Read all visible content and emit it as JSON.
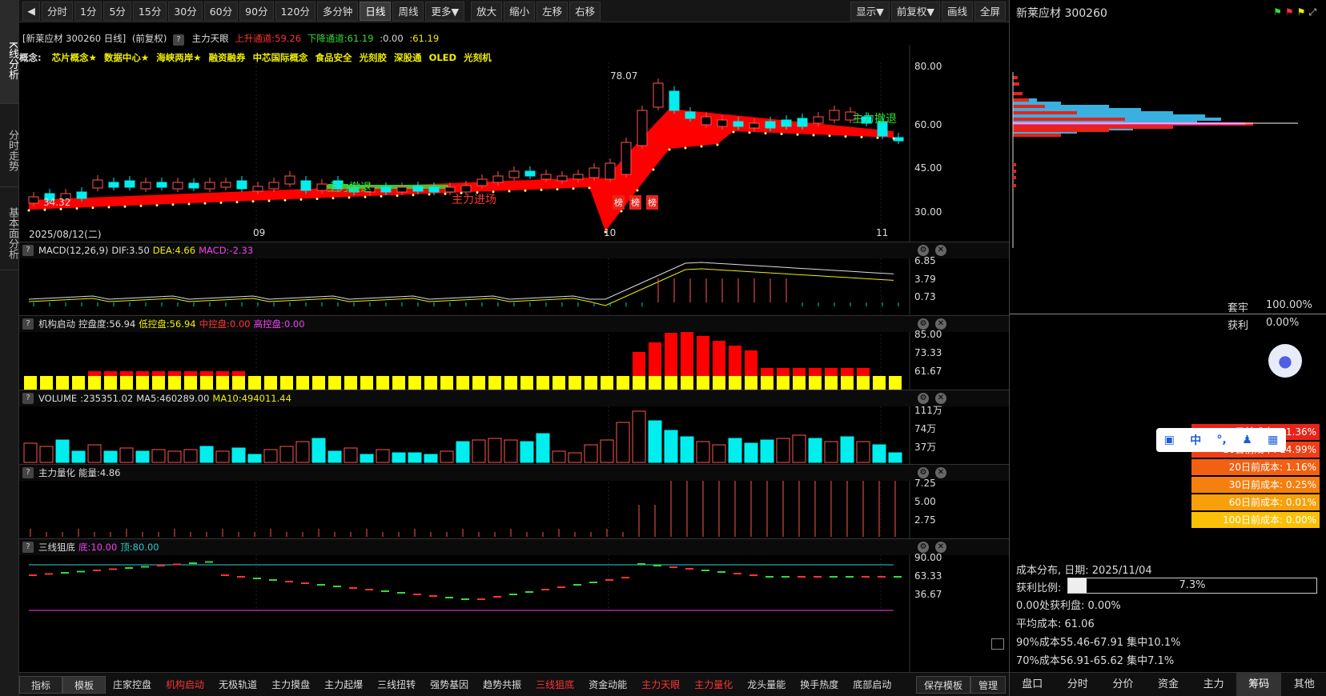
{
  "left_nav": {
    "items": [
      "K线分析",
      "分时走势",
      "基本面分析"
    ]
  },
  "toolbar": {
    "periods": [
      "分时",
      "1分",
      "5分",
      "15分",
      "30分",
      "60分",
      "90分",
      "120分",
      "多分钟",
      "日线",
      "周线",
      "更多▼"
    ],
    "actions": [
      "放大",
      "缩小",
      "左移",
      "右移"
    ],
    "right": [
      "显示▼",
      "前复权▼",
      "画线",
      "全屏"
    ]
  },
  "header": {
    "stock": "[新莱应材 300260 日线]",
    "adjust": "(前复权)",
    "indicator": "主力天眼",
    "up_channel": "上升通道:59.26",
    "down_channel": "下降通道:61.19",
    "v1": ":0.00",
    "v2": ":61.19"
  },
  "concepts": {
    "label": "概念:",
    "items": [
      "芯片概念★",
      "数据中心★",
      "海峡两岸★",
      "融资融券",
      "中芯国际概念",
      "食品安全",
      "光刻胶",
      "深股通",
      "OLED",
      "光刻机"
    ]
  },
  "main_chart": {
    "price_ticks": [
      "80.00",
      "60.00",
      "45.00",
      "30.00"
    ],
    "date_labels": [
      "2025/08/12(二)",
      "09",
      "10",
      "11"
    ],
    "annotations": {
      "high": "78.07",
      "low": "34.32",
      "exit1": "主力撤退",
      "entry": "主力进场",
      "exit2": "主力撤退",
      "bang": "榜"
    }
  },
  "macd": {
    "title": "MACD(12,26,9)",
    "dif": "DIF:3.50",
    "dea": "DEA:4.66",
    "macd": "MACD:-2.33",
    "ticks": [
      "6.85",
      "3.79",
      "0.73"
    ]
  },
  "inst": {
    "title": "机构启动",
    "ctrl": "控盘度:56.94",
    "low": "低控盘:56.94",
    "mid": "中控盘:0.00",
    "high": "高控盘:0.00",
    "ticks": [
      "85.00",
      "73.33",
      "61.67"
    ]
  },
  "volume": {
    "title": "VOLUME",
    "v": ":235351.02",
    "ma5": "MA5:460289.00",
    "ma10": "MA10:494011.44",
    "ticks": [
      "111万",
      "74万",
      "37万"
    ]
  },
  "energy": {
    "title": "主力量化",
    "v": "能量:4.86",
    "ticks": [
      "7.25",
      "5.00",
      "2.75"
    ]
  },
  "three": {
    "title": "三线狙底",
    "bottom": "底:10.00",
    "top": "顶:80.00",
    "ticks": [
      "90.00",
      "63.33",
      "36.67"
    ]
  },
  "bottom_tabs": [
    "指标",
    "模板",
    "庄家控盘",
    "机构启动",
    "无极轨道",
    "主力摸盘",
    "主力起爆",
    "三线扭转",
    "强势基因",
    "趋势共振",
    "三线狙底",
    "资金动能",
    "主力天眼",
    "主力量化",
    "龙头量能",
    "换手热度",
    "底部启动",
    "保存模板",
    "管理"
  ],
  "right_panel": {
    "title": "新莱应材 300260",
    "trapped": "套牢",
    "trapped_pct": "100.00%",
    "profit": "获利",
    "profit_pct": "0.00%",
    "cost_bars": [
      {
        "label": "5日前成本: 41.36%",
        "color": "#e8231a"
      },
      {
        "label": "10日前成本: 14.99%",
        "color": "#ee3f16"
      },
      {
        "label": "20日前成本: 1.16%",
        "color": "#f26012"
      },
      {
        "label": "30日前成本: 0.25%",
        "color": "#f5800e"
      },
      {
        "label": "60日前成本: 0.01%",
        "color": "#f8a00a"
      },
      {
        "label": "100日前成本: 0.00%",
        "color": "#fbc006"
      }
    ],
    "dist_date": "成本分布, 日期: 2025/11/04",
    "profit_ratio_label": "获利比例:",
    "profit_ratio": "7.3%",
    "profit_ratio_value": 0.073,
    "zero_profit": "0.00处获利盘: 0.00%",
    "avg_cost": "平均成本: 61.06",
    "cost90": "90%成本55.46-67.91 集中10.1%",
    "cost70": "70%成本56.91-65.62 集中7.1%",
    "tabs": [
      "盘口",
      "分时",
      "分价",
      "资金",
      "主力",
      "筹码",
      "其他"
    ]
  },
  "ime": {
    "items": [
      "中",
      "°,"
    ]
  }
}
